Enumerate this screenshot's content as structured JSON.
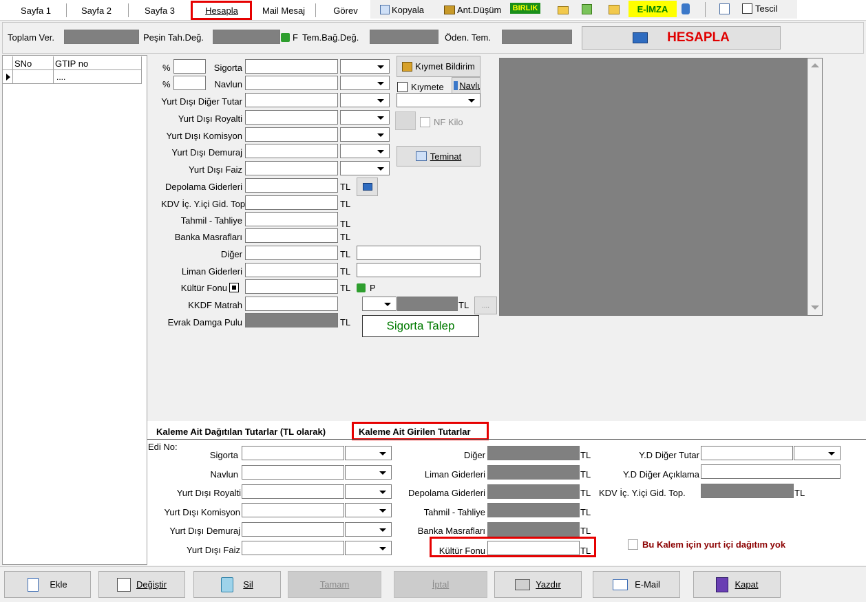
{
  "tabs": [
    {
      "label": "Sayfa 1"
    },
    {
      "label": "Sayfa 2"
    },
    {
      "label": "Sayfa 3"
    },
    {
      "label": "Hesapla"
    },
    {
      "label": "Mail Mesaj"
    },
    {
      "label": "Görev"
    }
  ],
  "toolbar": {
    "kopyala": "Kopyala",
    "ant_dusum": "Ant.Düşüm",
    "birlik": "BIRLIK",
    "eimza": "E-İMZA",
    "tescil": "Tescil"
  },
  "summary": {
    "toplam_ver": "Toplam Ver.",
    "pesin_tah": "Peşin Tah.Değ.",
    "f_label": "F",
    "tem_bag": "Tem.Bağ.Değ.",
    "oden_tem": "Öden. Tem.",
    "hesapla": "HESAPLA"
  },
  "grid": {
    "col1": "SNo",
    "col2": "GTIP no",
    "row1_gtip": "...."
  },
  "form": {
    "pct": "%",
    "sigorta": "Sigorta",
    "navlun": "Navlun",
    "yd_diger_tutar": "Yurt Dışı Diğer Tutar",
    "yd_royalti": "Yurt Dışı Royalti",
    "yd_komisyon": "Yurt Dışı Komisyon",
    "yd_demuraj": "Yurt Dışı Demuraj",
    "yd_faiz": "Yurt Dışı Faiz",
    "depolama": "Depolama Giderleri",
    "kdv_ic": "KDV İç. Y.içi Gid. Top",
    "tahmil": "Tahmil - Tahliye",
    "banka": "Banka Masrafları",
    "diger": "Diğer",
    "liman": "Liman Giderleri",
    "kultur": "Kültür Fonu",
    "kkdf": "KKDF Matrah",
    "evrak": "Evrak Damga Pulu",
    "tl": "TL",
    "p": "P",
    "kiymet_bildirim": "Kıymet Bildirim",
    "kiymete": "Kıymete",
    "navlu": "Navlu",
    "nf_kilo": "NF Kilo",
    "teminat": "Teminat",
    "sigorta_talep": "Sigorta Talep",
    "ellipsis": "...."
  },
  "section_tabs": {
    "dagitilan": "Kaleme Ait Dağıtılan Tutarlar (TL olarak)",
    "girilen": "Kaleme Ait Girilen Tutarlar"
  },
  "lower": {
    "edi_no": "Edi No:",
    "sigorta": "Sigorta",
    "navlun": "Navlun",
    "yd_royalti": "Yurt Dışı Royalti",
    "yd_komisyon": "Yurt Dışı Komisyon",
    "yd_demuraj": "Yurt Dışı Demuraj",
    "yd_faiz": "Yurt Dışı Faiz",
    "diger": "Diğer",
    "liman": "Liman Giderleri",
    "depolama": "Depolama Giderleri",
    "tahmil": "Tahmil - Tahliye",
    "banka": "Banka Masrafları",
    "kultur": "Kültür Fonu",
    "yd_diger_tutar": "Y.D Diğer Tutar",
    "yd_diger_aciklama": "Y.D Diğer Açıklama",
    "kdv_ic": "KDV İç. Y.içi Gid. Top.",
    "tl": "TL",
    "yurt_ici_yok": "Bu Kalem için yurt içi dağıtım yok"
  },
  "buttons": {
    "ekle": "Ekle",
    "degistir": "Değiştir",
    "sil": "Sil",
    "tamam": "Tamam",
    "iptal": "İptal",
    "yazdir": "Yazdır",
    "email": "E-Mail",
    "kapat": "Kapat"
  }
}
